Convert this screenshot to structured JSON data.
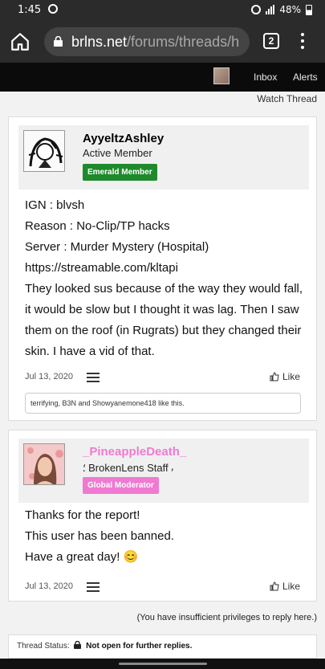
{
  "status_bar": {
    "time": "1:45",
    "battery": "48%"
  },
  "browser": {
    "url_host": "brlns.net",
    "url_path": "/forums/threads/h",
    "tab_count": "2"
  },
  "site_nav": {
    "inbox": "Inbox",
    "alerts": "Alerts"
  },
  "watch_thread": "Watch Thread",
  "posts": [
    {
      "username": "AyyeltzAshley",
      "user_title": "Active Member",
      "badge": "Emerald Member",
      "badge_color": "#1e8a2c",
      "username_color": "#111111",
      "lines": [
        "IGN : blvsh",
        "Reason : No-Clip/TP hacks",
        "Server : Murder Mystery (Hospital)",
        "https://streamable.com/kltapi",
        "They looked sus because of the way they would fall, it would be slow but I thought it was lag. Then I saw them on the roof (in Rugrats) but they changed their skin. I have a vid of that."
      ],
      "date": "Jul 13, 2020",
      "like_label": "Like",
      "likes_text": "terrifying, B3N and Showyanemone418 like this."
    },
    {
      "username": "_PineappleDeath_",
      "user_title": "⸵ BrokenLens Staff ⸴",
      "badge": "Global Moderator",
      "badge_color": "#f07ad2",
      "username_color": "#f07ad2",
      "lines": [
        "Thanks for the report!",
        "This user has been banned.",
        "Have a great day! 😊"
      ],
      "date": "Jul 13, 2020",
      "like_label": "Like"
    }
  ],
  "reply_note": "(You have insufficient privileges to reply here.)",
  "thread_status": {
    "label": "Thread Status:",
    "value": "Not open for further replies."
  }
}
